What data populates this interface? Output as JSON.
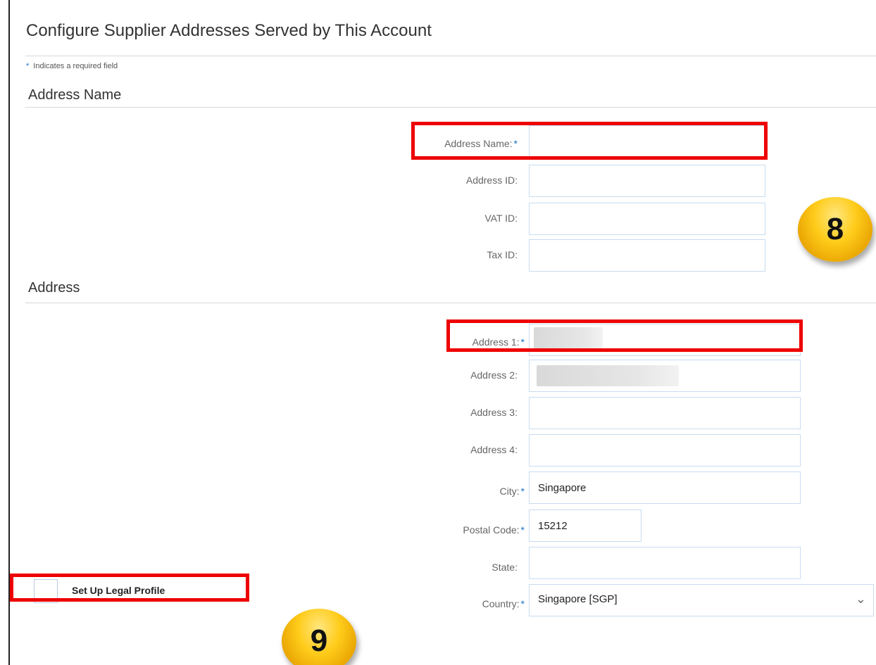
{
  "page": {
    "title": "Configure Supplier Addresses Served by This Account",
    "required_note_star": "*",
    "required_note": "Indicates a required field"
  },
  "sections": {
    "address_name": "Address Name",
    "address": "Address"
  },
  "fields": {
    "address_name": {
      "label": "Address Name:",
      "required": "*",
      "value": ""
    },
    "address_id": {
      "label": "Address ID:",
      "value": ""
    },
    "vat_id": {
      "label": "VAT ID:",
      "value": ""
    },
    "tax_id": {
      "label": "Tax ID:",
      "value": ""
    },
    "address1": {
      "label": "Address 1:",
      "required": "*",
      "value": ""
    },
    "address2": {
      "label": "Address 2:",
      "value": ""
    },
    "address3": {
      "label": "Address 3:",
      "value": ""
    },
    "address4": {
      "label": "Address 4:",
      "value": ""
    },
    "city": {
      "label": "City:",
      "required": "*",
      "value": "Singapore"
    },
    "postal_code": {
      "label": "Postal Code:",
      "required": "*",
      "value": "15212"
    },
    "state": {
      "label": "State:",
      "value": ""
    },
    "country": {
      "label": "Country:",
      "required": "*",
      "value": "Singapore  [SGP]",
      "icon": "chevron-down-icon"
    }
  },
  "legal_profile": {
    "label": "Set Up Legal Profile",
    "checked": false
  },
  "badges": {
    "step8": "8",
    "step9": "9"
  },
  "colors": {
    "highlight": "#ee0000",
    "badge": "#ffcc1a",
    "required_star": "#1a73c8"
  }
}
